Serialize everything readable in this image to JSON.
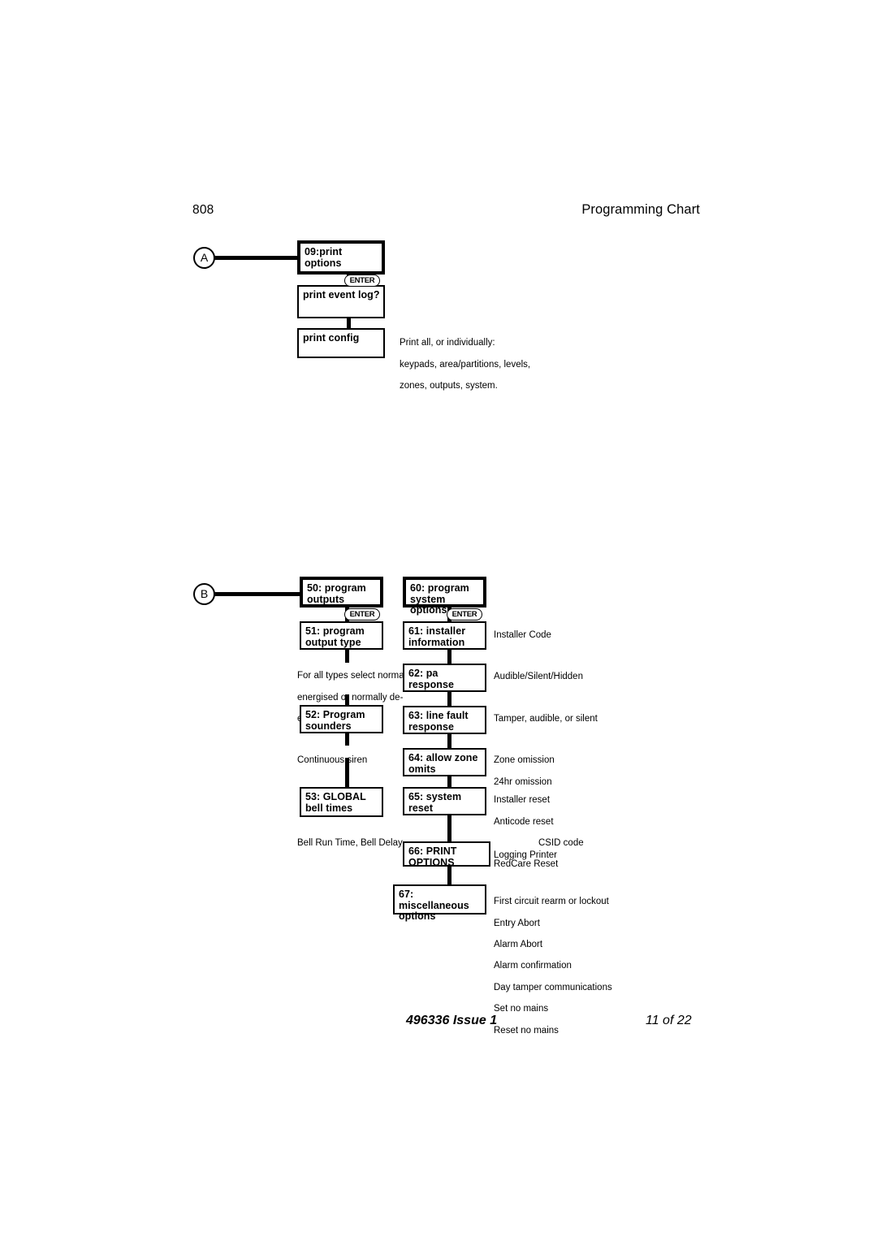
{
  "header": {
    "page_number": "808",
    "title": "Programming Chart"
  },
  "footer": {
    "doc_ref": "496336 Issue 1",
    "page_of": "11 of 22"
  },
  "connectors": {
    "a_label": "A",
    "b_label": "B"
  },
  "enter_label": "ENTER",
  "chart_a": {
    "boxes": [
      {
        "line1": "09:print options",
        "line2": ""
      },
      {
        "line1": "print event log?",
        "line2": ""
      },
      {
        "line1": "print config",
        "line2": ""
      }
    ],
    "notes": [
      {
        "line1": "Print all, or individually:",
        "line2": "keypads, area/partitions, levels,",
        "line3": "zones, outputs, system."
      }
    ]
  },
  "chart_b_left": {
    "boxes": [
      {
        "line1": "50: program",
        "line2": "outputs"
      },
      {
        "line1": "51: program",
        "line2": "output type"
      },
      {
        "line1": "52: Program",
        "line2": "sounders"
      },
      {
        "line1": "53: GLOBAL",
        "line2": "bell times"
      }
    ],
    "notes": [
      {
        "line1": "For all types select normally",
        "line2": "energised or normally de-",
        "line3": "energised."
      },
      {
        "line1": "Continuous siren"
      },
      {
        "line1": "Bell Run Time, Bell Delay"
      }
    ]
  },
  "chart_b_right": {
    "boxes": [
      {
        "line1": "60: program",
        "line2": "system options"
      },
      {
        "line1": "61: installer",
        "line2": "information"
      },
      {
        "line1": "62: pa response",
        "line2": ""
      },
      {
        "line1": "63: line fault",
        "line2": "response"
      },
      {
        "line1": "64: allow zone",
        "line2": "omits"
      },
      {
        "line1": "65: system reset",
        "line2": ""
      },
      {
        "line1": "66: PRINT OPTIONS",
        "line2": ""
      },
      {
        "line1": "67: miscellaneous",
        "line2": "options"
      }
    ],
    "notes": {
      "n61": {
        "line1": "Installer Code"
      },
      "n62": {
        "line1": "Audible/Silent/Hidden"
      },
      "n63": {
        "line1": "Tamper, audible, or silent"
      },
      "n64": {
        "line1": "Zone omission",
        "line2": "24hr omission"
      },
      "n65": {
        "line1": "Installer reset",
        "line2": "Anticode reset",
        "line3": "CSID code",
        "line4": "RedCare Reset"
      },
      "n66": {
        "line1": "Logging Printer"
      },
      "n67": {
        "line1": "First circuit rearm or lockout",
        "line2": "Entry Abort",
        "line3": "Alarm Abort",
        "line4": "Alarm confirmation",
        "line5": "Day tamper communications",
        "line6": "Set no mains",
        "line7": "Reset no mains"
      }
    }
  }
}
